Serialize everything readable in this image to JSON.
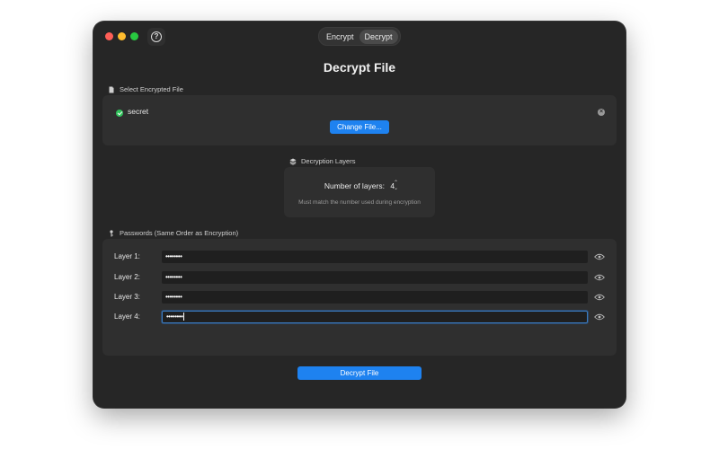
{
  "window": {
    "tabs": [
      {
        "label": "Encrypt",
        "active": false
      },
      {
        "label": "Decrypt",
        "active": true
      }
    ],
    "help_icon": "question-circle-icon"
  },
  "title": "Decrypt File",
  "file_section": {
    "label": "Select Encrypted File",
    "icon": "document-icon",
    "file_name": "secret",
    "status_icon": "checkmark-circle-icon",
    "clear_icon": "x-circle-icon",
    "change_button": "Change File..."
  },
  "layers_section": {
    "label": "Decryption Layers",
    "icon": "stack-icon",
    "count_label": "Number of layers:",
    "count_value": "4",
    "hint": "Must match the number used during encryption"
  },
  "passwords_section": {
    "label": "Passwords (Same Order as Encryption)",
    "icon": "key-icon",
    "rows": [
      {
        "label": "Layer 1:",
        "masked": "••••••••",
        "focused": false
      },
      {
        "label": "Layer 2:",
        "masked": "••••••••",
        "focused": false
      },
      {
        "label": "Layer 3:",
        "masked": "••••••••",
        "focused": false
      },
      {
        "label": "Layer 4:",
        "masked": "••••••••",
        "focused": true
      }
    ],
    "reveal_icon": "eye-icon"
  },
  "decrypt_button": "Decrypt File",
  "colors": {
    "accent": "#1e82f0",
    "success": "#30c25b",
    "window_bg": "#262626",
    "panel_bg": "#2f2f2f"
  }
}
